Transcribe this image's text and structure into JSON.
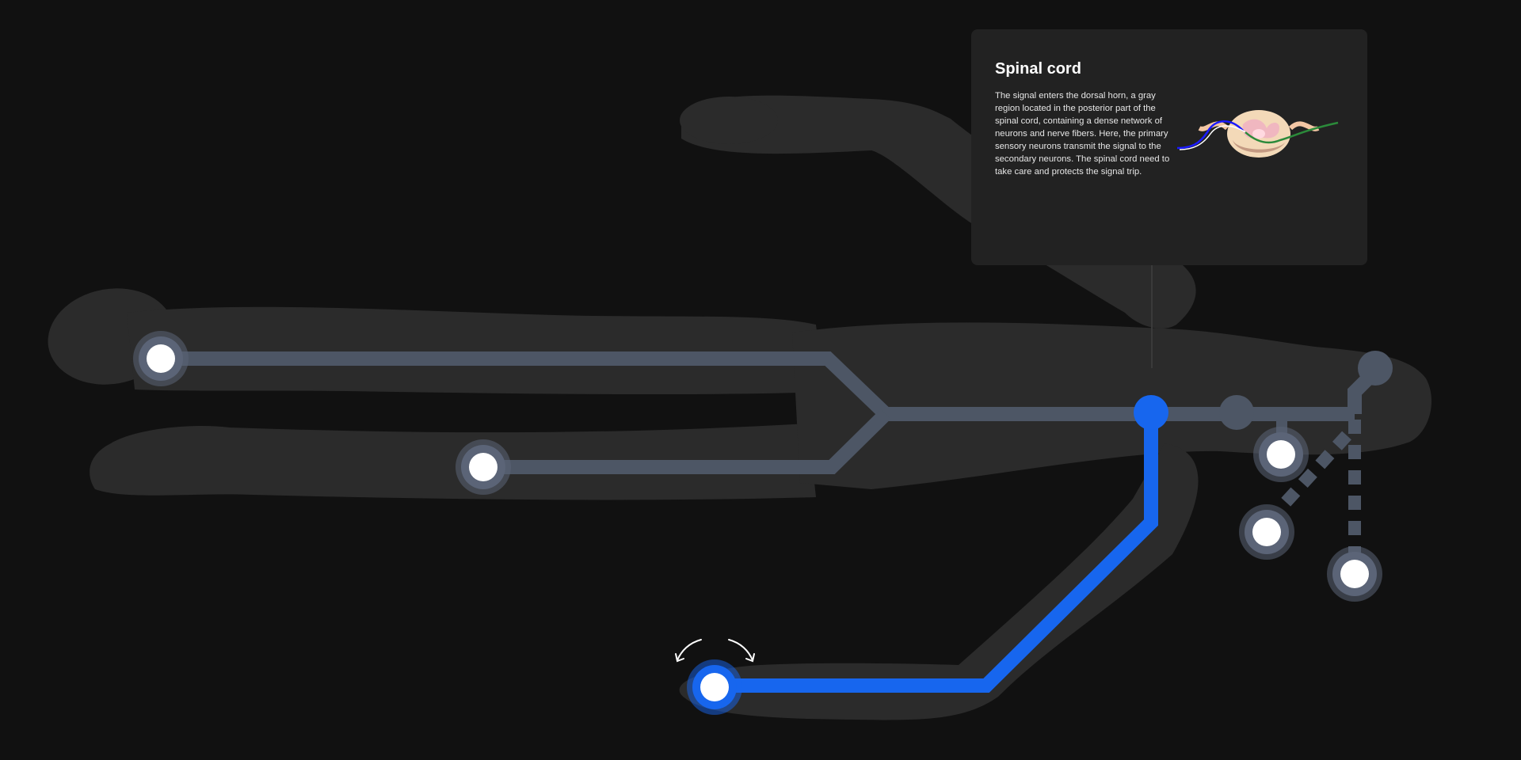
{
  "info_card": {
    "title": "Spinal cord",
    "description": "The signal enters the dorsal horn, a gray region located in the posterior part of the spinal cord, containing a dense network of neurons and nerve fibers. Here, the primary sensory neurons transmit the signal to the secondary neurons. The spinal cord need to take care and protects the signal trip.",
    "illustration_icon": "spinal-cord-cross-section"
  },
  "pathways": [
    {
      "name": "left-arm",
      "active": false
    },
    {
      "name": "left-hand",
      "active": false
    },
    {
      "name": "foot",
      "active": true
    },
    {
      "name": "right-hip",
      "active": false
    },
    {
      "name": "right-knee",
      "active": false
    },
    {
      "name": "right-foot",
      "active": false
    }
  ],
  "selected_node": "spinal-cord",
  "colors": {
    "background": "#111111",
    "body_silhouette": "#2b2b2b",
    "inactive_path": "#4d5665",
    "inactive_node_ring": "#5b6477",
    "active_path": "#1766ee",
    "card_background": "#222222",
    "text": "#ffffff"
  }
}
